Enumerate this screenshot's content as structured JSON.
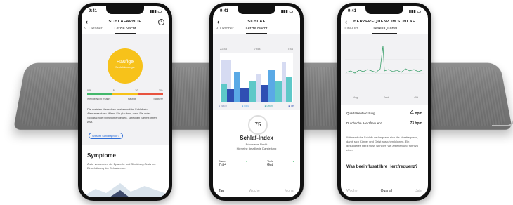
{
  "phone1": {
    "time": "9:41",
    "title": "SCHLAFAPNOE",
    "help": "?",
    "tab_prev": "9. Oktober",
    "tab_active": "Letzte Nacht",
    "result": "Häufige",
    "result_sub": "Schlafatmungs-",
    "scale_nums": [
      "0-5",
      "15",
      "30",
      "30+"
    ],
    "scale_labels": [
      "Wenige/Nicht erkannt",
      "Häufige",
      "Schwere"
    ],
    "paragraph": "Die meisten Menschen erleben mit im Schlaf ein Atemaussetzen. Wenn Sie glauben, dass Sie unter Schlafapnoe Symptomen leiden, sprechen Sie mit Ihrem Arzt.",
    "button": "Was ist Schlafapnoe?",
    "section_title": "Symptome",
    "section_text": "Ärzte verwenden die Epworth- und Stockberg-Tests zur Einschätzung der Schlafapnoe."
  },
  "phone2": {
    "time": "9:41",
    "title": "SCHLAF",
    "tab_prev": "9. Oktober",
    "tab_active": "Letzte Nacht",
    "graph_left": "22:48",
    "graph_center": "7h54",
    "graph_right": "7:44",
    "legend": [
      "Wach",
      "REM",
      "Leicht",
      "Tief"
    ],
    "score": "75",
    "score_title": "Schlaf-Index",
    "score_sub": "Erholsame Nacht",
    "score_sub2": "Hier eine detaillierte Darstellung",
    "stat1_label": "Dauer",
    "stat1_value": "7h54",
    "stat2_label": "Tiefe",
    "stat2_value": "Gut",
    "bottom_tabs": [
      "Tag",
      "Woche",
      "Monat"
    ]
  },
  "phone3": {
    "time": "9:41",
    "title": "HERZFREQUENZ IM SCHLAF",
    "tab_prev": "Juni-Okt",
    "tab_active": "Dieses Quartal",
    "xlabels": [
      "Aug",
      "Sept",
      "Okt"
    ],
    "row1_label": "Quartalsentwicklung",
    "row1_value": "4",
    "row1_unit": "bpm",
    "row2_label": "Durchschn. Herzfrequenz",
    "row2_value": "73 bpm",
    "paragraph": "Während des Schlafs verlangsamt sich die Herzfrequenz, damit sich Körper und Geist ausruhen können. Ein gesünderes Herz muss weniger hart arbeiten und führt zu einer.",
    "section_title": "Was beeinflusst Ihre Herzfrequenz?",
    "bottom_tabs": [
      "Woche",
      "Quartal",
      "Jahr"
    ]
  },
  "colors": {
    "sun": "#f7c21a",
    "scale_green": "#43b86b",
    "scale_yellow": "#f7c21a",
    "scale_red": "#e8533f",
    "awake": "#d6dbf2",
    "rem": "#5aa9e6",
    "light": "#5ec8c8",
    "deep": "#2f4fb3",
    "hr_line": "#3aa06a"
  }
}
